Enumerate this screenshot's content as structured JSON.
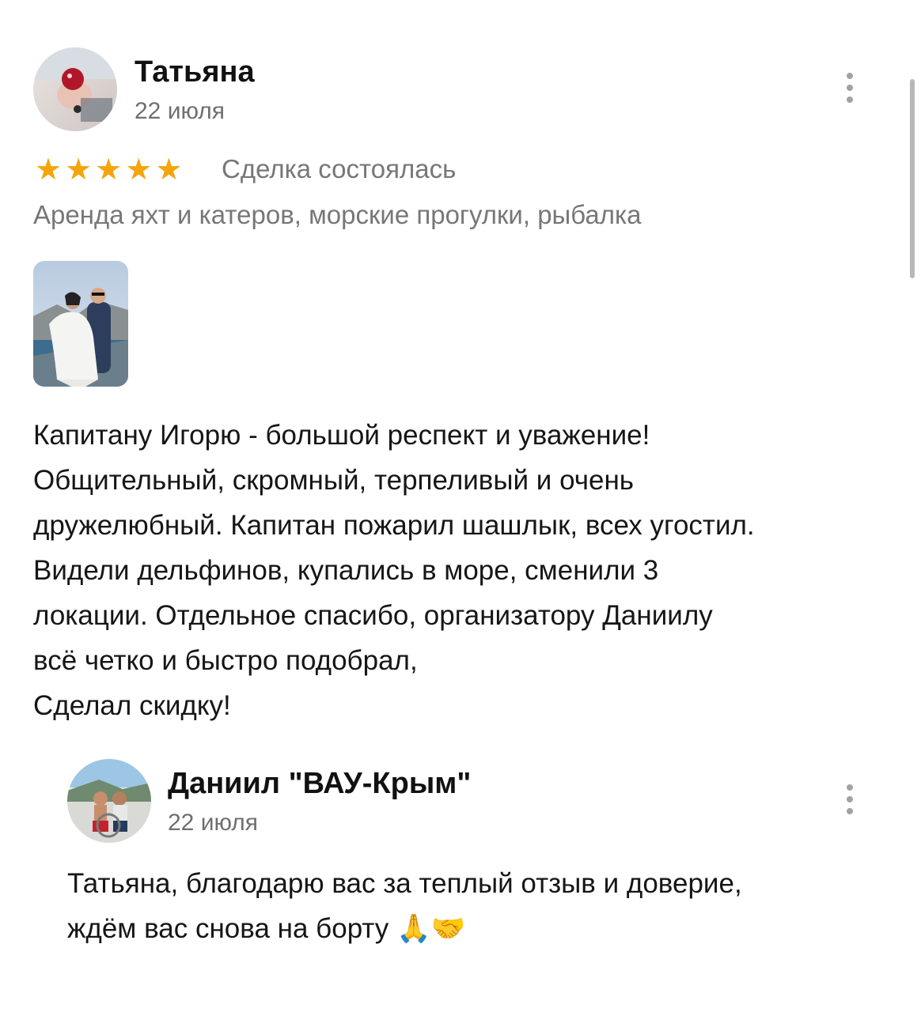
{
  "review": {
    "author": "Татьяна",
    "date": "22 июля",
    "rating": 5,
    "stars": [
      "★",
      "★",
      "★",
      "★",
      "★"
    ],
    "status": "Сделка состоялась",
    "category": "Аренда яхт и катеров, морские прогулки, рыбалка",
    "text_lines": [
      "Капитану Игорю - большой респект и уважение!",
      "Общительный, скромный, терпеливый и очень",
      "дружелюбный. Капитан пожарил шашлык, всех угостил.",
      "Видели дельфинов, купались в море, сменили 3",
      "локации. Отдельное спасибо, организатору Даниилу",
      "всё четко и быстро подобрал,",
      "Сделал скидку!"
    ]
  },
  "reply": {
    "author": "Даниил \"ВАУ-Крым\"",
    "date": "22 июля",
    "text_lines": [
      "Татьяна, благодарю вас за теплый отзыв и доверие,",
      "ждём вас снова на борту 🙏🤝"
    ]
  },
  "colors": {
    "star": "#f4a40c",
    "secondary_text": "#777777",
    "menu_dots": "#a2a2a2"
  },
  "icons": {
    "menu": "more-vertical-icon",
    "star": "star-icon"
  }
}
